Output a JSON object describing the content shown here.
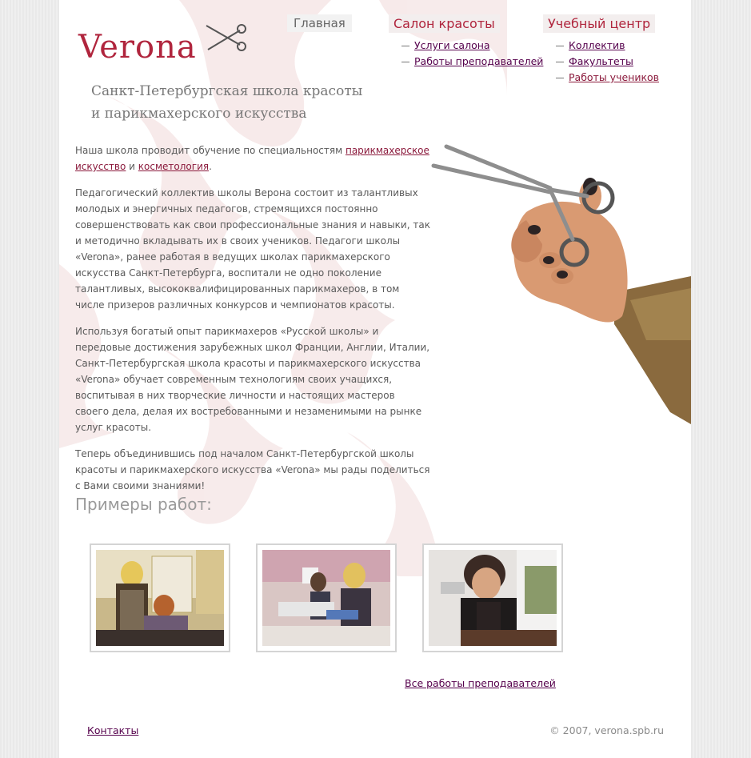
{
  "logo": {
    "text": "Verona"
  },
  "nav": {
    "home": "Главная",
    "salon": {
      "label": "Салон красоты",
      "items": [
        "Услуги салона",
        "Работы преподавателей"
      ]
    },
    "school": {
      "label": "Учебный центр",
      "items": [
        "Коллектив",
        "Факультеты",
        "Работы учеников"
      ]
    }
  },
  "tagline": {
    "line1": "Санкт-Петербургская школа красоты",
    "line2": "и парикмахерского искусства"
  },
  "content": {
    "p1_text": "Наша школа проводит обучение по специальностям ",
    "p1_link1": "парикмахерское искусство",
    "p1_and": " и ",
    "p1_link2": "косметология",
    "p1_end": ".",
    "p2": "Педагогический коллектив школы Верона состоит из талантливых молодых и энергичных педагогов, стремящихся постоянно совершенствовать как свои профессиональные знания и навыки, так и методично вкладывать их в своих учеников. Педагоги школы «Verona», ранее работая в ведущих школах парикмахерского искусства Санкт-Петербурга, воспитали не одно поколение талантливых, высококвалифицированных парикмахеров, в том числе призеров различных конкурсов и чемпионатов красоты.",
    "p3": "Используя богатый опыт парикмахеров «Русской школы» и передовые достижения зарубежных школ Франции, Англии, Италии, Санкт-Петербургская школа красоты и парикмахерского искусства «Verona» обучает современным технологиям своих учащихся, воспитывая в них творческие личности и настоящих мастеров своего дела, делая их востребованными и незаменимыми на рынке услуг красоты.",
    "p4": "Теперь объединившись под началом Санкт-Петербургской школы красоты и парикмахерского искусства «Verona» мы рады поделиться с Вами своими знаниями!"
  },
  "examples": {
    "title": "Примеры работ:",
    "all_link": "Все работы преподавателей"
  },
  "footer": {
    "contacts": "Контакты",
    "copyright": "© 2007, verona.spb.ru"
  },
  "colors": {
    "brand": "#b0253d",
    "link": "#55004c",
    "text": "#5a5a5a"
  }
}
